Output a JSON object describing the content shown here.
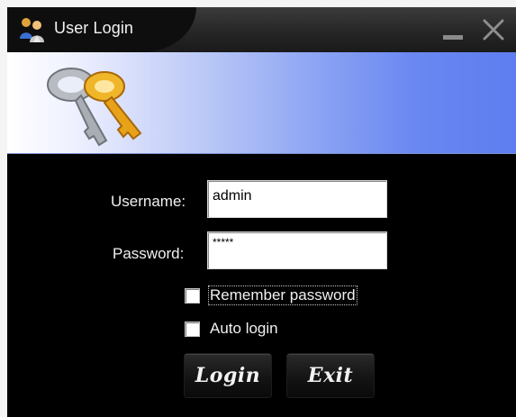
{
  "window": {
    "title": "User Login",
    "icons": {
      "app": "users-icon",
      "minimize": "minimize-icon",
      "close": "close-icon",
      "banner": "keys-icon"
    }
  },
  "form": {
    "username_label": "Username:",
    "username_value": "admin",
    "password_label": "Password:",
    "password_value": "*****",
    "remember_label": "Remember password",
    "remember_checked": false,
    "autologin_label": "Auto login",
    "autologin_checked": false
  },
  "buttons": {
    "login_label": "Login",
    "exit_label": "Exit"
  },
  "colors": {
    "window_bg": "#000000",
    "banner_start": "#ffffff",
    "banner_end": "#5e7df0",
    "key_gold": "#e8a21a",
    "key_silver": "#9aa0a6"
  }
}
